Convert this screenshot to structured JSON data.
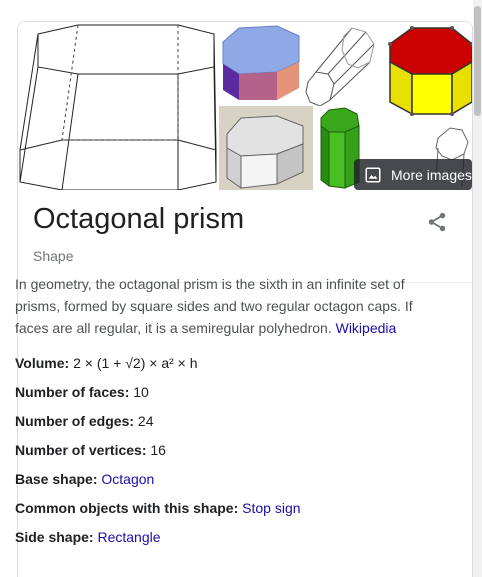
{
  "more_images_label": "More images",
  "title": "Octagonal prism",
  "subtitle": "Shape",
  "description": {
    "text": "In geometry, the octagonal prism is the sixth in an infinite set of prisms, formed by square sides and two regular octagon caps. If faces are all regular, it is a semiregular polyhedron.",
    "source_link": "Wikipedia"
  },
  "facts": [
    {
      "key": "Volume:",
      "value": "2 × (1 + √2) × a² × h",
      "is_link": false
    },
    {
      "key": "Number of faces:",
      "value": "10",
      "is_link": false
    },
    {
      "key": "Number of edges:",
      "value": "24",
      "is_link": false
    },
    {
      "key": "Number of vertices:",
      "value": "16",
      "is_link": false
    },
    {
      "key": "Base shape:",
      "value": "Octagon",
      "is_link": true
    },
    {
      "key": "Common objects with this shape:",
      "value": "Stop sign",
      "is_link": true
    },
    {
      "key": "Side shape:",
      "value": "Rectangle",
      "is_link": true
    }
  ],
  "colors": {
    "link": "#1a0dab",
    "text": "#202124",
    "secondary": "#70757a",
    "body_text": "#4d5156",
    "border": "#dadce0"
  },
  "icons": {
    "share": "share-icon",
    "more_images": "image-icon"
  }
}
